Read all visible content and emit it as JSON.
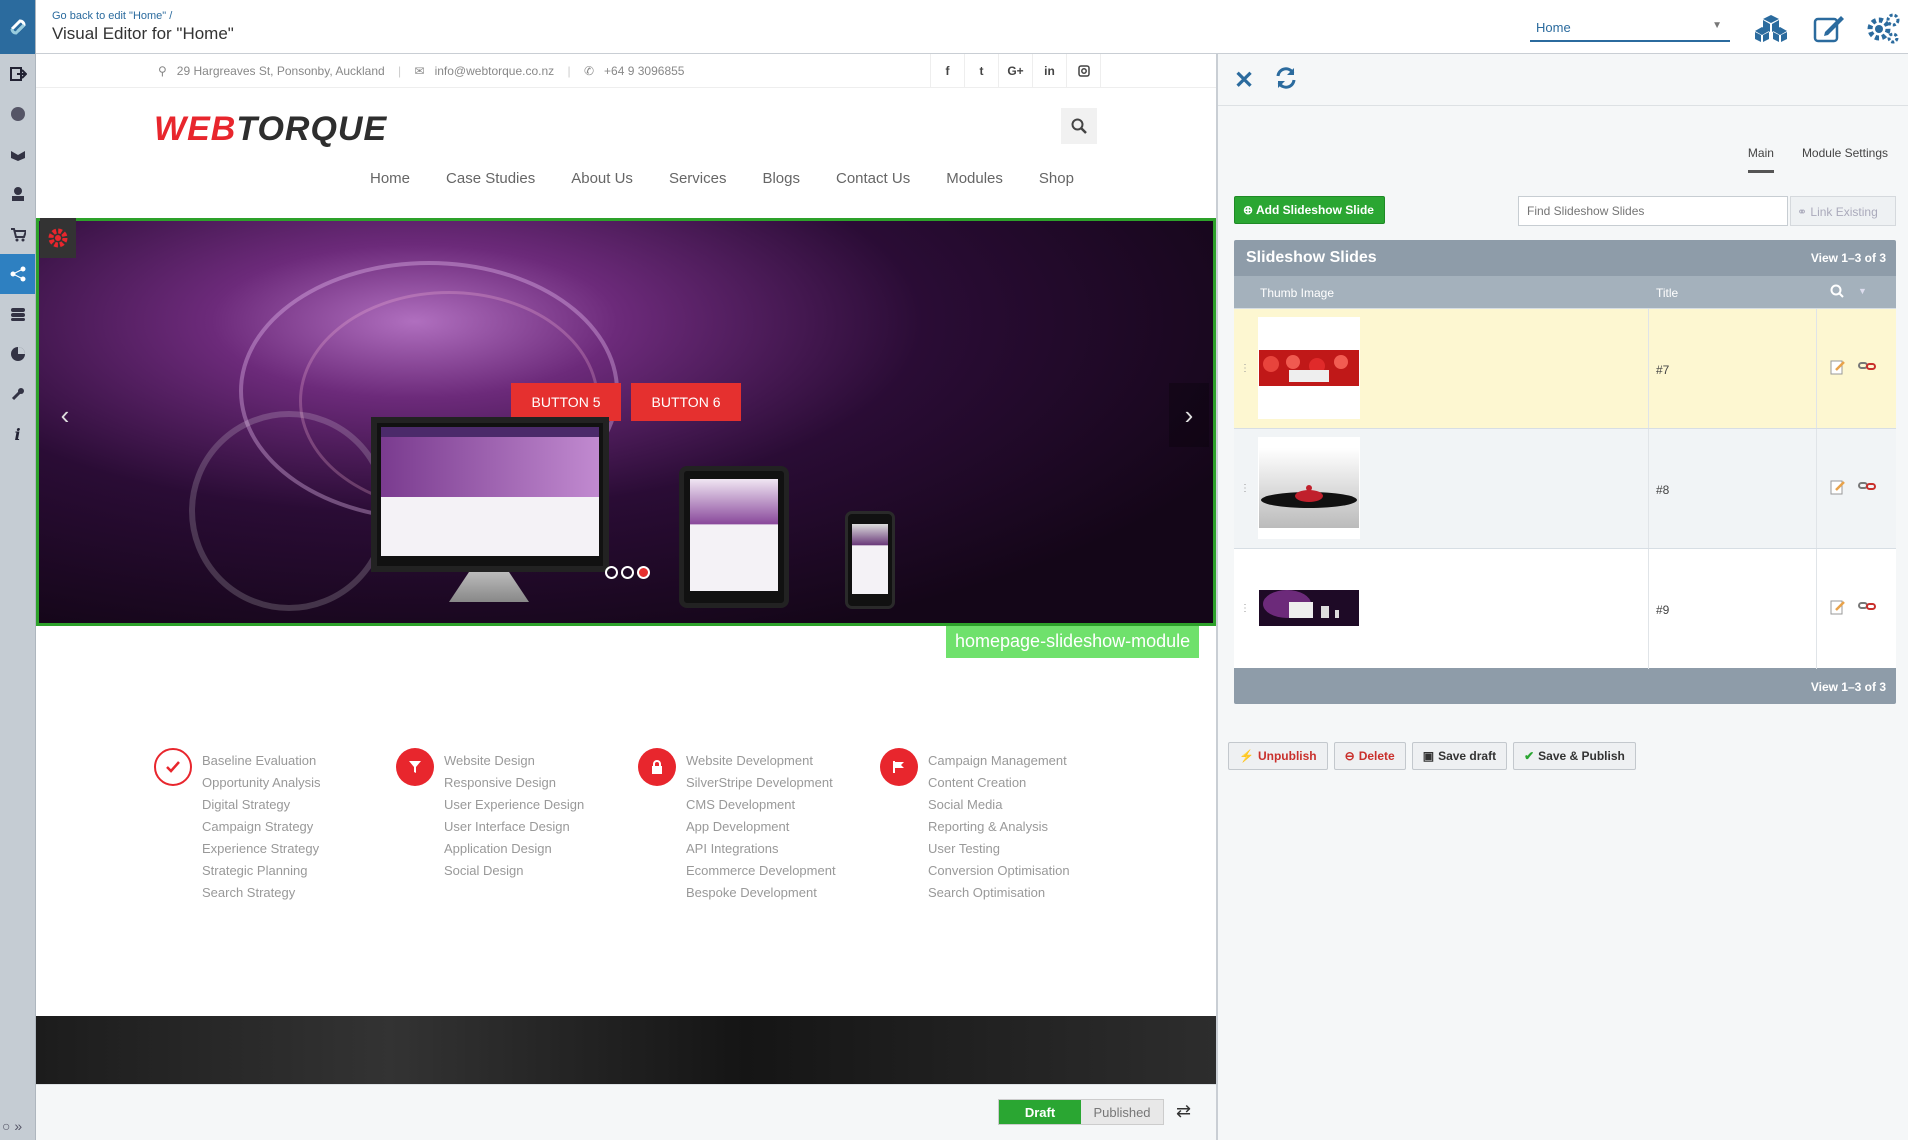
{
  "header": {
    "breadcrumb": "Go back to edit \"Home\" /",
    "title": "Visual Editor for \"Home\"",
    "page_select": "Home"
  },
  "site": {
    "contact": {
      "address": "29 Hargreaves St, Ponsonby, Auckland",
      "email": "info@webtorque.co.nz",
      "phone": "+64 9 3096855"
    },
    "social": [
      "f",
      "t",
      "G+",
      "in",
      "ig"
    ],
    "brand_a": "WEB",
    "brand_b": "TORQUE",
    "nav": [
      "Home",
      "Case Studies",
      "About Us",
      "Services",
      "Blogs",
      "Contact Us",
      "Modules",
      "Shop"
    ],
    "slider": {
      "button1": "BUTTON 5",
      "button2": "BUTTON 6",
      "active_slide_index": 2,
      "module_label": "homepage-slideshow-module"
    },
    "services": [
      {
        "icon": "check-icon",
        "items": [
          "Baseline Evaluation",
          "Opportunity Analysis",
          "Digital Strategy",
          "Campaign Strategy",
          "Experience Strategy",
          "Strategic Planning",
          "Search Strategy"
        ]
      },
      {
        "icon": "funnel-icon",
        "items": [
          "Website Design",
          "Responsive Design",
          "User Experience Design",
          "User Interface Design",
          "Application Design",
          "Social Design"
        ]
      },
      {
        "icon": "lock-icon",
        "items": [
          "Website Development",
          "SilverStripe Development",
          "CMS Development",
          "App Development",
          "API Integrations",
          "Ecommerce Development",
          "Bespoke Development"
        ]
      },
      {
        "icon": "flag-icon",
        "items": [
          "Campaign Management",
          "Content Creation",
          "Social Media",
          "Reporting & Analysis",
          "User Testing",
          "Conversion Optimisation",
          "Search Optimisation"
        ]
      }
    ]
  },
  "footer": {
    "draft_label": "Draft",
    "published_label": "Published"
  },
  "panel": {
    "tabs": [
      "Main",
      "Module Settings"
    ],
    "add_button": "Add Slideshow Slide",
    "find_placeholder": "Find Slideshow Slides",
    "link_existing": "Link Existing",
    "grid_title": "Slideshow Slides",
    "count": "View 1–3 of 3",
    "col_thumb": "Thumb Image",
    "col_title": "Title",
    "rows": [
      {
        "title": "#7",
        "thumb": "red-roses"
      },
      {
        "title": "#8",
        "thumb": "water-drop"
      },
      {
        "title": "#9",
        "thumb": "purple-devices"
      }
    ],
    "buttons": {
      "unpublish": "Unpublish",
      "delete": "Delete",
      "save_draft": "Save draft",
      "save_publish": "Save & Publish"
    }
  },
  "colors": {
    "accent": "#2b6b9e",
    "brand_red": "#e8262d",
    "green": "#2aa632",
    "highlight_row": "#fdf7d1"
  }
}
